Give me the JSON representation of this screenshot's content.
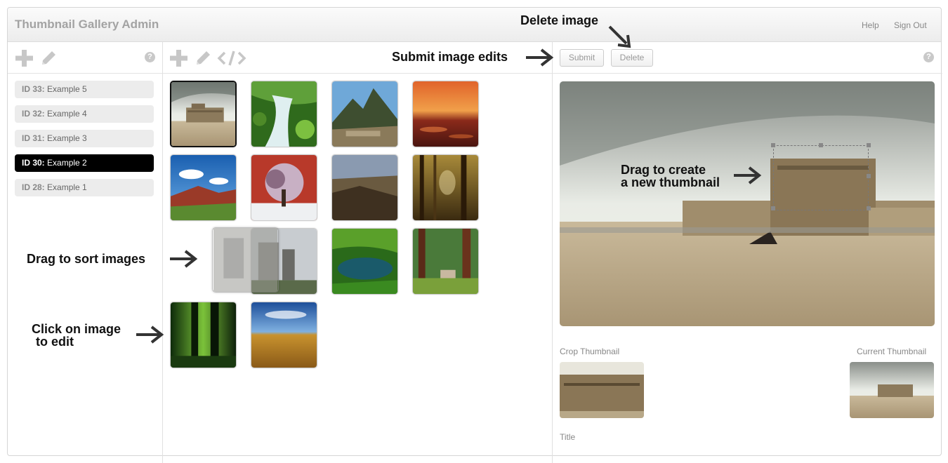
{
  "app": {
    "title": "Thumbnail Gallery Admin",
    "help": "Help",
    "sign_out": "Sign Out"
  },
  "galleries": [
    {
      "id": "ID 33:",
      "name": "Example 5",
      "active": false
    },
    {
      "id": "ID 32:",
      "name": "Example 4",
      "active": false
    },
    {
      "id": "ID 31:",
      "name": "Example 3",
      "active": false
    },
    {
      "id": "ID 30:",
      "name": "Example 2",
      "active": true
    },
    {
      "id": "ID 28:",
      "name": "Example 1",
      "active": false
    }
  ],
  "icons": {
    "left_toolbar": [
      "plus-icon",
      "pencil-icon",
      "help-icon"
    ],
    "mid_toolbar": [
      "plus-icon",
      "pencil-icon",
      "code-icon"
    ],
    "help_glyph": "?"
  },
  "thumbnails": [
    "palace",
    "waterfall",
    "mountain-ruins",
    "sunset-shore",
    "red-mountains",
    "winter-tree",
    "canyon",
    "forest-path",
    "castle-ruins",
    "green-lake",
    "redwoods",
    "dark-forest",
    "wheat-field"
  ],
  "editor": {
    "submit_label": "Submit",
    "delete_label": "Delete",
    "crop_label": "Crop Thumbnail",
    "current_label": "Current Thumbnail",
    "title_label": "Title"
  },
  "annotations": {
    "delete_image": "Delete image",
    "submit_edits": "Submit image edits",
    "drag_create_1": "Drag to create",
    "drag_create_2": "a new thumbnail",
    "drag_sort": "Drag to sort images",
    "click_edit_1": "Click on image",
    "click_edit_2": "to edit"
  },
  "colors": {
    "active_item": "#000000",
    "title_text": "#a3a3a3",
    "annotation": "#111111"
  }
}
